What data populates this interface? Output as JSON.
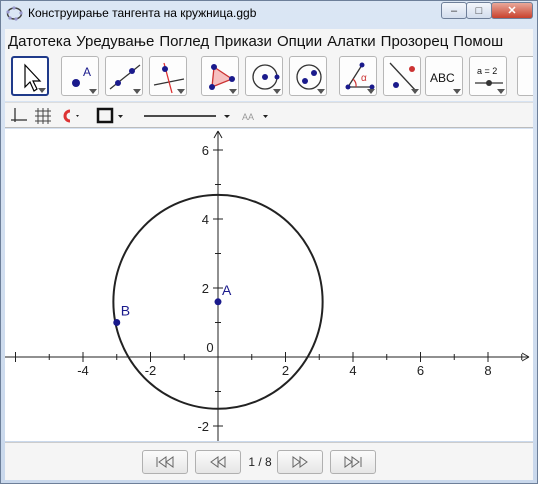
{
  "window": {
    "title": "Конструирање тангента на кружница.ggb"
  },
  "window_buttons": {
    "minimize": "‒",
    "maximize": "□",
    "close": "✕"
  },
  "menu": [
    "Датотека",
    "Уредување",
    "Поглед",
    "Прикази",
    "Опции",
    "Алатки",
    "Прозорец",
    "Помош"
  ],
  "toolbar": {
    "tools": [
      {
        "name": "move",
        "icon": "move-arrow-icon",
        "selected": true
      },
      {
        "name": "point",
        "icon": "point-icon",
        "label": "A"
      },
      {
        "name": "line",
        "icon": "line-through-two-points-icon"
      },
      {
        "name": "perpendicular",
        "icon": "perpendicular-line-icon"
      },
      {
        "name": "polygon",
        "icon": "polygon-icon"
      },
      {
        "name": "circle",
        "icon": "circle-center-point-icon"
      },
      {
        "name": "conic",
        "icon": "conic-five-points-icon"
      },
      {
        "name": "angle",
        "icon": "angle-icon",
        "label": "α"
      },
      {
        "name": "reflect",
        "icon": "reflect-about-line-icon"
      },
      {
        "name": "text",
        "icon": "text-icon",
        "label": "ABC"
      },
      {
        "name": "slider",
        "icon": "slider-icon",
        "label": "a = 2"
      }
    ]
  },
  "stylebar": {
    "icons": [
      "axes-icon",
      "grid-icon",
      "point-capture-icon",
      "color-icon",
      "line-style-icon",
      "label-style-icon"
    ],
    "label_style_text": "AA"
  },
  "graphics": {
    "x_ticks": [
      -4,
      -2,
      0,
      2,
      4,
      6,
      8
    ],
    "y_ticks": [
      -2,
      0,
      2,
      4,
      6
    ],
    "points": [
      {
        "label": "A",
        "x": 0,
        "y": 1.6
      },
      {
        "label": "B",
        "x": -3,
        "y": 1.0
      }
    ],
    "circle": {
      "center_x": 0,
      "center_y": 1.6,
      "radius": 3.1,
      "color": "#222222"
    },
    "point_color": "#1a1a8c"
  },
  "navigation": {
    "page_indicator": "1 / 8"
  }
}
